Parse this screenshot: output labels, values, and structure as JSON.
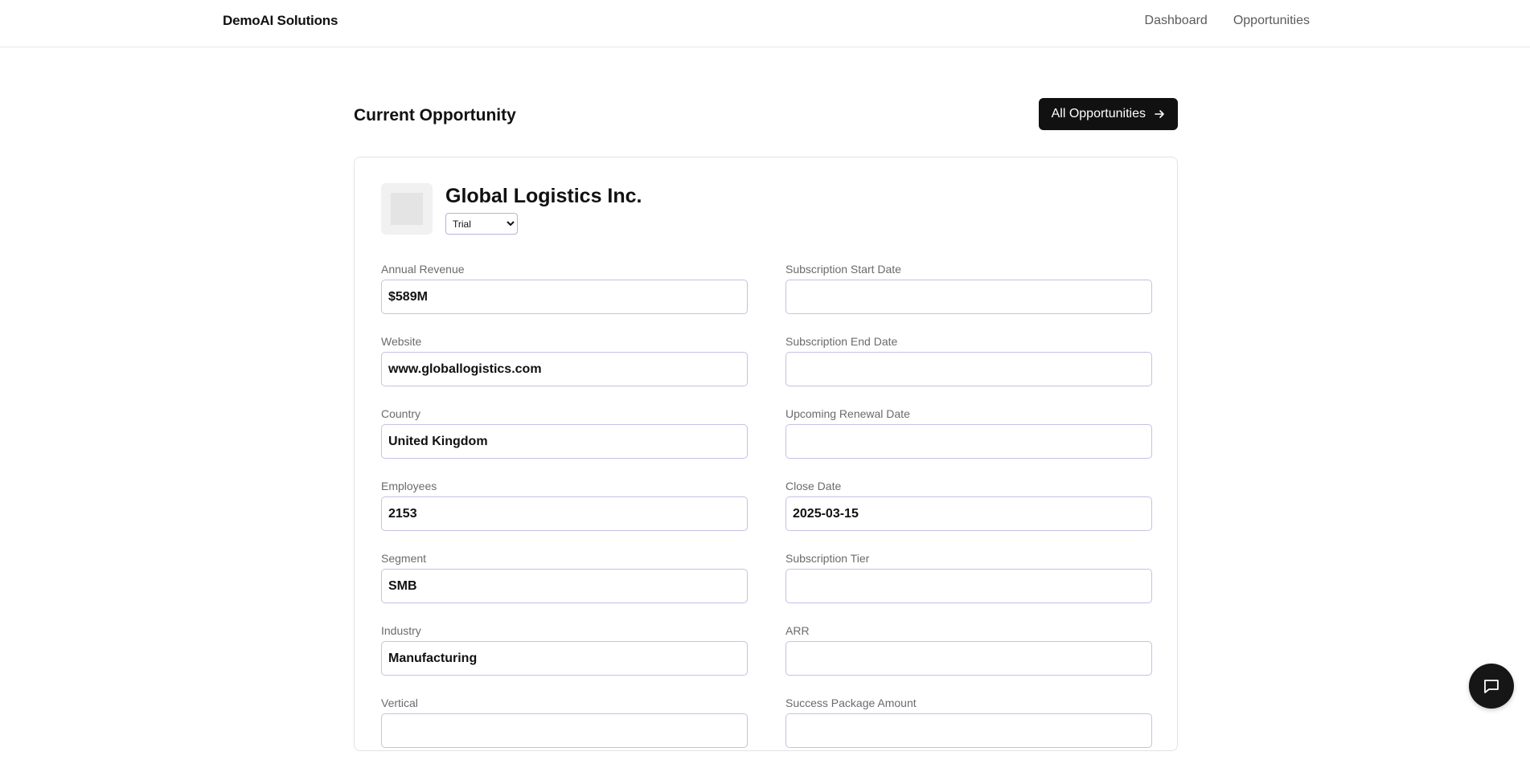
{
  "header": {
    "brand": "DemoAI Solutions",
    "nav": [
      "Dashboard",
      "Opportunities"
    ]
  },
  "page": {
    "title": "Current Opportunity",
    "all_button_label": "All Opportunities",
    "all_button_icon": "arrow-right-icon"
  },
  "company": {
    "name": "Global Logistics Inc.",
    "logo_icon": "company-logo-placeholder",
    "status": "Trial"
  },
  "fields_left": [
    {
      "label": "Annual Revenue",
      "value": ""
    },
    {
      "label": "Website",
      "value": ""
    },
    {
      "label": "Country",
      "value": ""
    },
    {
      "label": "Employees",
      "value": ""
    },
    {
      "label": "Segment",
      "value": ""
    },
    {
      "label": "Industry",
      "value": ""
    },
    {
      "label": "Vertical",
      "value": ""
    }
  ],
  "fields_right": [
    {
      "label": "Subscription Start Date",
      "value": ""
    },
    {
      "label": "Subscription End Date",
      "value": ""
    },
    {
      "label": "Upcoming Renewal Date",
      "value": ""
    },
    {
      "label": "Close Date",
      "value": ""
    },
    {
      "label": "Subscription Tier",
      "value": ""
    },
    {
      "label": "ARR",
      "value": ""
    },
    {
      "label": "Success Package Amount",
      "value": ""
    }
  ],
  "values_left": [
    "$589M",
    "www.globallogistics.com",
    "United Kingdom",
    "2153",
    "SMB",
    "Manufacturing",
    ""
  ],
  "values_right": [
    "",
    "",
    "",
    "2025-03-15",
    "",
    "",
    ""
  ],
  "chat": {
    "icon": "chat-bubble-icon"
  },
  "colors": {
    "accent_dark": "#111111",
    "input_border": "#c9bfe3"
  }
}
